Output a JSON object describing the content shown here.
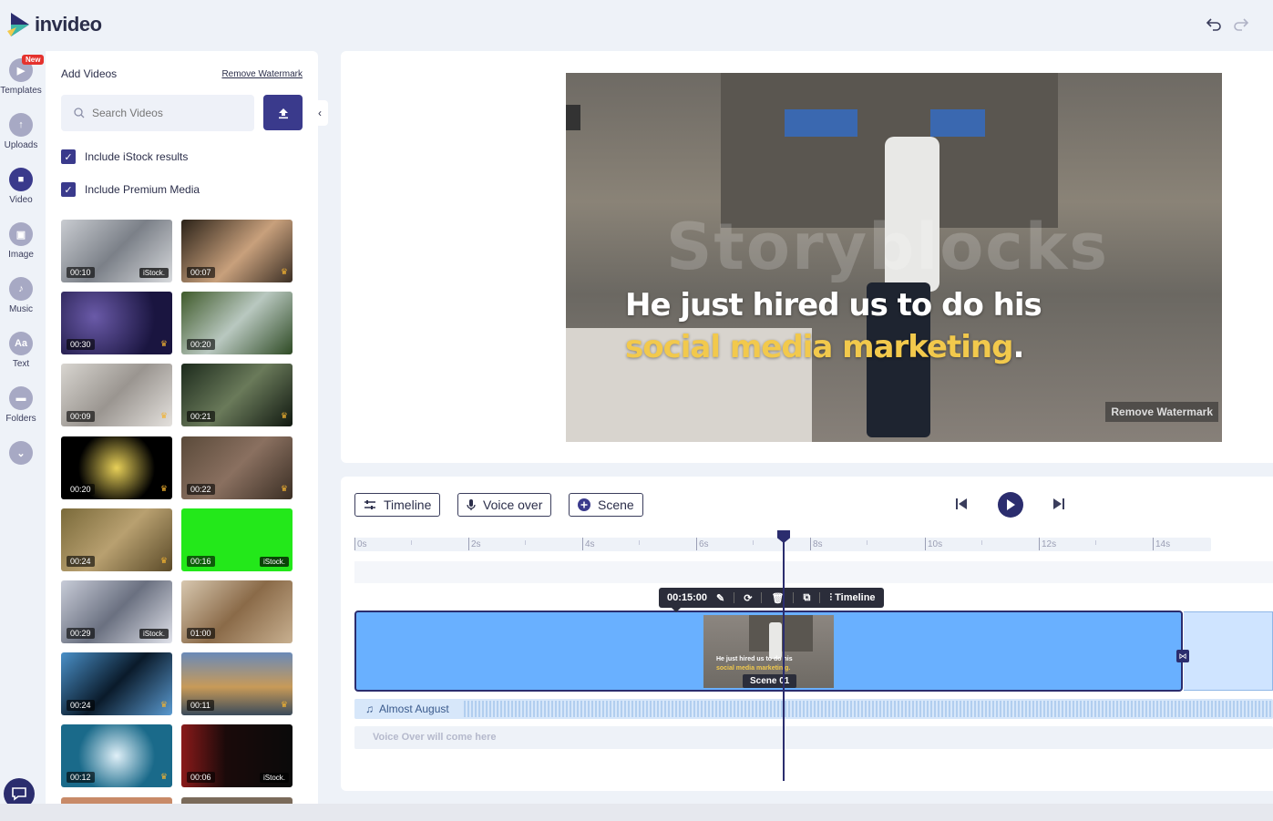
{
  "app": {
    "logo_text": "invideo"
  },
  "rail": {
    "items": [
      {
        "label": "Templates",
        "badge": "New"
      },
      {
        "label": "Uploads"
      },
      {
        "label": "Video"
      },
      {
        "label": "Image"
      },
      {
        "label": "Music"
      },
      {
        "label": "Text",
        "icon_text": "Aa"
      },
      {
        "label": "Folders"
      }
    ]
  },
  "panel": {
    "title": "Add Videos",
    "remove_watermark": "Remove Watermark",
    "search_placeholder": "Search Videos",
    "include_istock": "Include iStock results",
    "include_premium": "Include Premium Media",
    "thumbs": [
      {
        "duration": "00:10",
        "istock": "iStock."
      },
      {
        "duration": "00:07"
      },
      {
        "duration": "00:30"
      },
      {
        "duration": "00:20"
      },
      {
        "duration": "00:09"
      },
      {
        "duration": "00:21"
      },
      {
        "duration": "00:20"
      },
      {
        "duration": "00:22"
      },
      {
        "duration": "00:24"
      },
      {
        "duration": "00:16",
        "istock": "iStock."
      },
      {
        "duration": "00:29",
        "istock": "iStock."
      },
      {
        "duration": "01:00"
      },
      {
        "duration": "00:24"
      },
      {
        "duration": "00:11"
      },
      {
        "duration": "00:12"
      },
      {
        "duration": "00:06",
        "istock": "iStock."
      }
    ]
  },
  "preview": {
    "caption_line1": "He just hired us to do his",
    "caption_line2": "social media marketing",
    "caption_dot": ".",
    "watermark": "Storyblocks",
    "remove_watermark": "Remove Watermark"
  },
  "timeline": {
    "timeline_btn": "Timeline",
    "voiceover_btn": "Voice over",
    "scene_btn": "Scene",
    "ruler": [
      "0s",
      "2s",
      "4s",
      "6s",
      "8s",
      "10s",
      "12s",
      "14s"
    ],
    "toolbar_duration": "00:15:00",
    "toolbar_timeline": "Timeline",
    "scene_label": "Scene 01",
    "scene_thumb_line1": "He just hired us to do his",
    "scene_thumb_line2": "social media marketin g.",
    "audio_title": "Almost August",
    "voice_placeholder": "Voice Over will come here"
  }
}
